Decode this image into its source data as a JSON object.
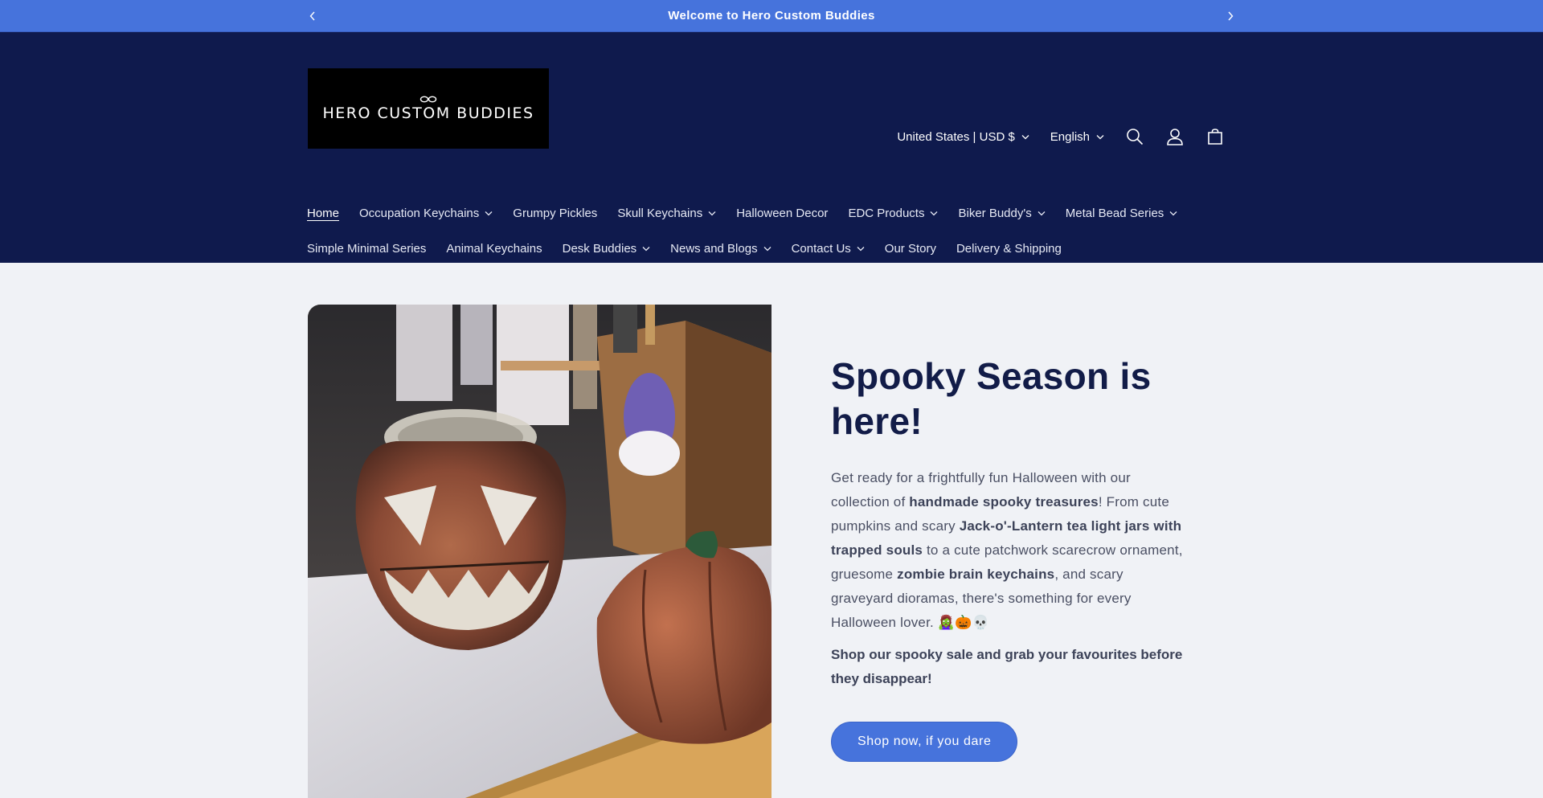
{
  "announcement": {
    "message": "Welcome to Hero Custom Buddies"
  },
  "brand": {
    "logo_text": "HERO CUSTOM BUDDIES",
    "colors": {
      "header_bg": "#0f1a4d",
      "accent": "#4673dc",
      "page_bg": "#f0f2f6"
    }
  },
  "header": {
    "country_selector": "United States | USD $",
    "language_selector": "English"
  },
  "nav": {
    "row1": [
      {
        "label": "Home",
        "active": true,
        "dropdown": false
      },
      {
        "label": "Occupation Keychains",
        "dropdown": true
      },
      {
        "label": "Grumpy Pickles",
        "dropdown": false
      },
      {
        "label": "Skull Keychains",
        "dropdown": true
      },
      {
        "label": "Halloween Decor",
        "dropdown": false
      },
      {
        "label": "EDC Products",
        "dropdown": true
      },
      {
        "label": "Biker Buddy's",
        "dropdown": true
      },
      {
        "label": "Metal Bead Series",
        "dropdown": true
      }
    ],
    "row2": [
      {
        "label": "Simple Minimal Series",
        "dropdown": false
      },
      {
        "label": "Animal Keychains",
        "dropdown": false
      },
      {
        "label": "Desk Buddies",
        "dropdown": true
      },
      {
        "label": "News and Blogs",
        "dropdown": true
      },
      {
        "label": "Contact Us",
        "dropdown": true
      },
      {
        "label": "Our Story",
        "dropdown": false
      },
      {
        "label": "Delivery & Shipping",
        "dropdown": false
      }
    ]
  },
  "hero": {
    "title": "Spooky Season is here!",
    "body": {
      "p1": "Get ready for a frightfully fun Halloween with our collection of ",
      "b1": "handmade spooky treasures",
      "p2": "! From cute pumpkins and scary ",
      "b2": "Jack-o'-Lantern tea light jars with trapped souls",
      "p3": " to a cute patchwork scarecrow ornament, gruesome ",
      "b3": "zombie brain keychains",
      "p4": ", and scary graveyard dioramas, there's something for every Halloween lover. ",
      "emoji": "🧟‍♀️🎃💀"
    },
    "cta_text": "Shop our spooky sale and grab your favourites before they disappear!",
    "button_label": "Shop now, if you dare"
  }
}
